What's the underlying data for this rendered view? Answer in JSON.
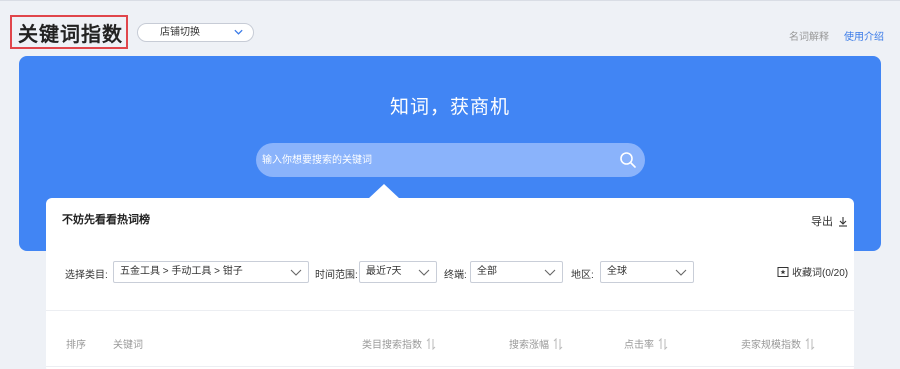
{
  "header": {
    "page_title": "关键词指数",
    "store_switch_label": "店铺切换",
    "term_link": "名词解释",
    "guide_link": "使用介绍"
  },
  "hero": {
    "title": "知词，获商机",
    "search_placeholder": "输入你想要搜索的关键词"
  },
  "hot_list": {
    "title": "不妨先看看热词榜",
    "export_label": "导出"
  },
  "filters": {
    "category_label": "选择类目:",
    "category_value": "五金工具 > 手动工具 > 钳子",
    "time_label": "时间范围:",
    "time_value": "最近7天",
    "channel_label": "终端:",
    "channel_value": "全部",
    "region_label": "地区:",
    "region_value": "全球",
    "favorites_label": "收藏词(0/20)"
  },
  "table": {
    "columns": [
      "排序",
      "关键词",
      "类目搜索指数",
      "搜索涨幅",
      "点击率",
      "卖家规模指数"
    ]
  },
  "colors": {
    "hero_blue": "#4185f4",
    "search_bg": "#8ab3fb",
    "link_blue": "#3a7be8",
    "highlight_red": "#e0454b"
  }
}
